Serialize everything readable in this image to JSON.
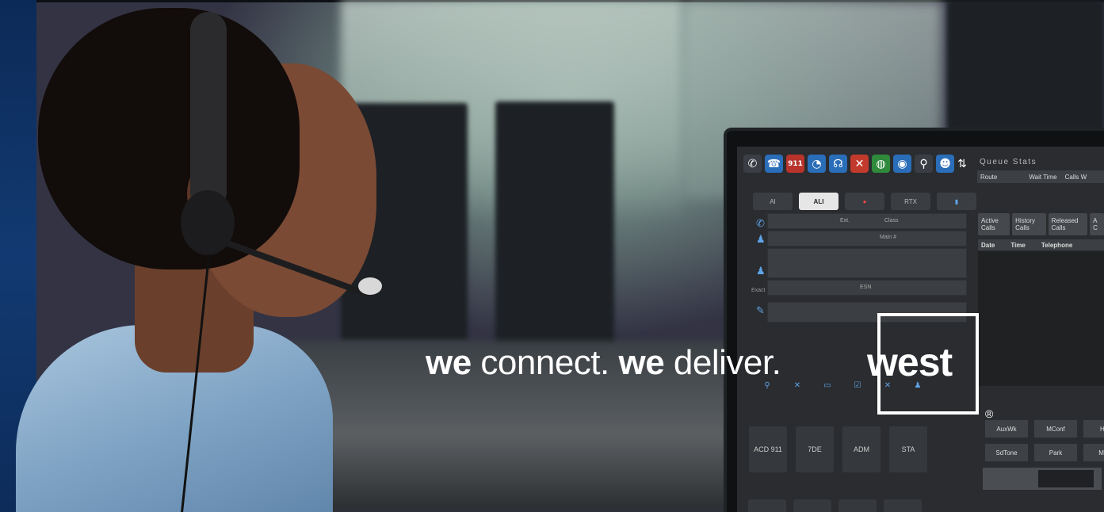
{
  "tagline": {
    "part1_bold": "we",
    "part1_rest": " connect. ",
    "part2_bold": "we",
    "part2_rest": " deliver."
  },
  "logo": {
    "word": "west",
    "registered": "®"
  },
  "console": {
    "toolbar_icons": [
      "phone-icon",
      "phone-icon",
      "911-icon",
      "ear-icon",
      "headset-icon",
      "close-icon",
      "globe-icon",
      "map-pin-icon",
      "pin-icon",
      "people-icon",
      "arrows-icon"
    ],
    "toolbar_911": "911",
    "tabs": [
      "AI",
      "ALI",
      "",
      "RTX",
      ""
    ],
    "field_labels": {
      "ext": "Ext.",
      "class": "Class",
      "main": "Main #",
      "esn": "ESN",
      "exact": "Exact"
    },
    "queue_stats": {
      "title": "Queue Stats",
      "headers": [
        "Route",
        "Wait Time",
        "Calls W"
      ]
    },
    "call_tabs": [
      "Active Calls",
      "History Calls",
      "Released Calls",
      "A C"
    ],
    "call_headers": [
      "Date",
      "Time",
      "Telephone"
    ],
    "function_buttons": [
      "AuxWk",
      "MConf",
      "Hol",
      "SdTone",
      "Park",
      "Mon"
    ],
    "acd_buttons": [
      "ACD 911",
      "7DE",
      "ADM",
      "STA"
    ]
  },
  "colors": {
    "brand_blue": "#123a72",
    "logo_white": "#ffffff"
  }
}
